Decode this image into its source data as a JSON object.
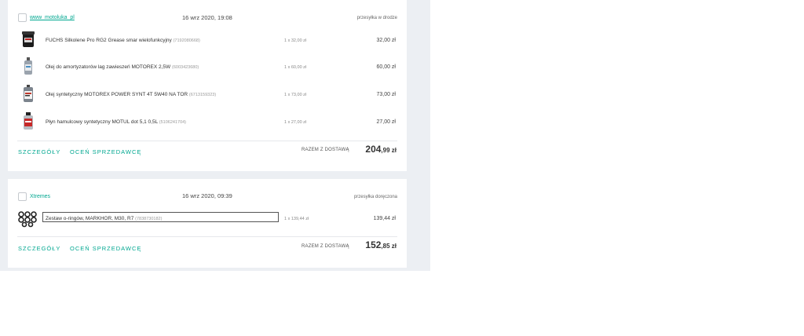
{
  "orders": [
    {
      "seller": "www_motoluka_pl",
      "date": "16 wrz 2020, 19:08",
      "status": "przesyłka w drodze",
      "items": [
        {
          "name": "FUCHS Silkolene Pro RG2 Grease smar wielofunkcyjny",
          "id": "(7192080668)",
          "qty": "1 x 32,00 zł",
          "price": "32,00 zł",
          "thumb_icon": "grease-tub-icon"
        },
        {
          "name": "Olej do amortyzatorów lag zawieszeń MOTOREX 2,5W",
          "id": "(6003423680)",
          "qty": "1 x 60,00 zł",
          "price": "60,00 zł",
          "thumb_icon": "oil-bottle-icon"
        },
        {
          "name": "Olej syntetyczny MOTOREX POWER SYNT 4T 5W40 NA TOR",
          "id": "(6713159323)",
          "qty": "1 x 73,00 zł",
          "price": "73,00 zł",
          "thumb_icon": "oil-can-icon"
        },
        {
          "name": "Płyn hamulcowy syntetyczny MOTUL dot 5,1 0,5L",
          "id": "(5106241704)",
          "qty": "1 x 27,00 zł",
          "price": "27,00 zł",
          "thumb_icon": "brake-fluid-icon"
        }
      ],
      "details_label": "SZCZEGÓŁY",
      "rate_label": "OCEŃ SPRZEDAWCĘ",
      "total_label": "RAZEM Z DOSTAWĄ",
      "total_int": "204",
      "total_dec": ",99 zł"
    },
    {
      "seller": "Xtremes",
      "date": "16 wrz 2020, 09:39",
      "status": "przesyłka doręczona",
      "items": [
        {
          "name": "Zestaw o-ringów, MARKHOR, M30, R7",
          "id": "(7838730182)",
          "qty": "1 x 139,44 zł",
          "price": "139,44 zł",
          "thumb_icon": "o-rings-icon"
        }
      ],
      "details_label": "SZCZEGÓŁY",
      "rate_label": "OCEŃ SPRZEDAWCĘ",
      "total_label": "RAZEM Z DOSTAWĄ",
      "total_int": "152",
      "total_dec": ",85 zł"
    }
  ],
  "colors": {
    "accent": "#00a790",
    "background": "#eceff3",
    "card": "#ffffff"
  }
}
